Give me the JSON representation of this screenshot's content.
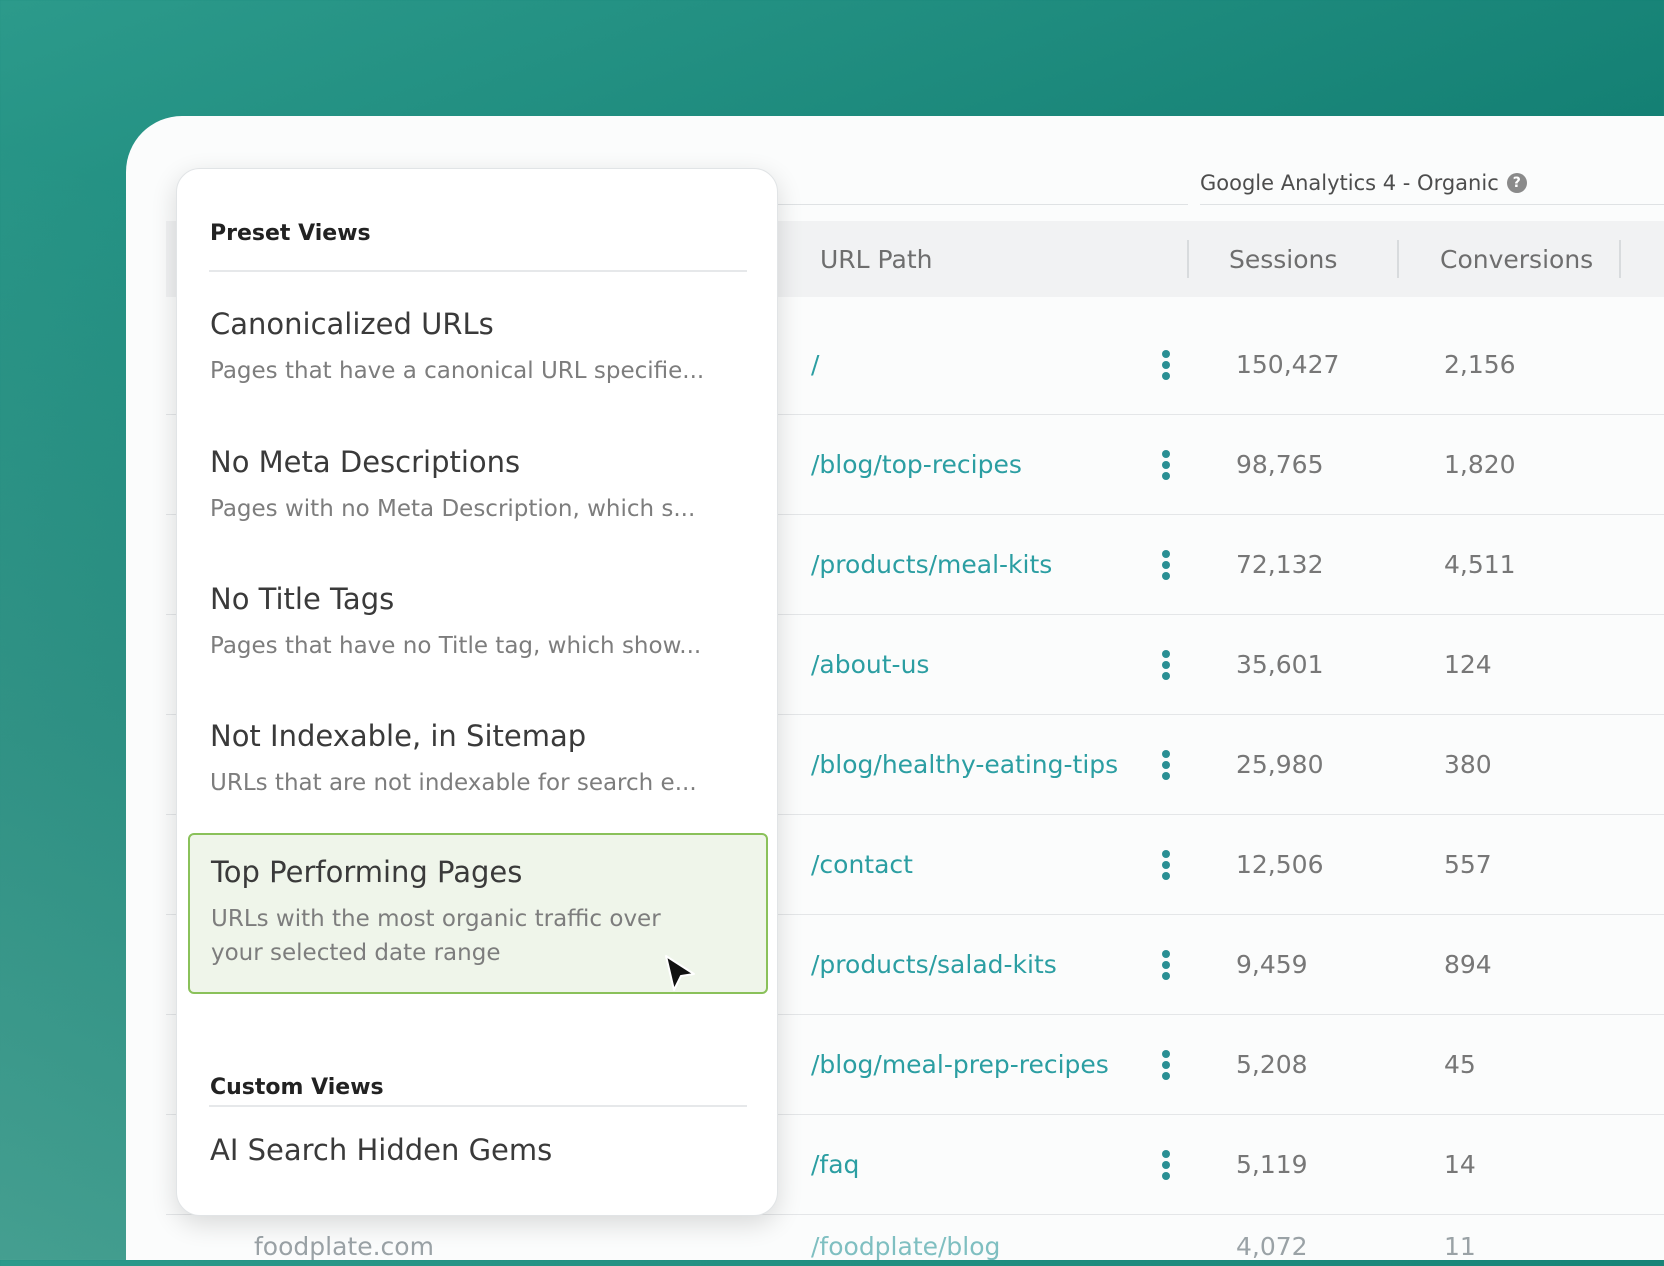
{
  "data_source": {
    "label": "Google Analytics 4 - Organic",
    "help_icon": "?"
  },
  "table": {
    "columns": [
      "URL Path",
      "Sessions",
      "Conversions"
    ],
    "rows": [
      {
        "url": "/",
        "sessions": "150,427",
        "conversions": "2,156"
      },
      {
        "url": "/blog/top-recipes",
        "sessions": "98,765",
        "conversions": "1,820"
      },
      {
        "url": "/products/meal-kits",
        "sessions": "72,132",
        "conversions": "4,511"
      },
      {
        "url": "/about-us",
        "sessions": "35,601",
        "conversions": "124"
      },
      {
        "url": "/blog/healthy-eating-tips",
        "sessions": "25,980",
        "conversions": "380"
      },
      {
        "url": "/contact",
        "sessions": "12,506",
        "conversions": "557"
      },
      {
        "url": "/products/salad-kits",
        "sessions": "9,459",
        "conversions": "894"
      },
      {
        "url": "/blog/meal-prep-recipes",
        "sessions": "5,208",
        "conversions": "45"
      },
      {
        "url": "/faq",
        "sessions": "5,119",
        "conversions": "14"
      }
    ],
    "partial_row": {
      "domain": "foodplate.com",
      "url": "/foodplate/blog",
      "sessions": "4,072",
      "conversions": "11"
    }
  },
  "dropdown": {
    "preset_title": "Preset Views",
    "presets": [
      {
        "title": "Canonicalized URLs",
        "desc": "Pages that have a canonical URL specifie..."
      },
      {
        "title": "No Meta Descriptions",
        "desc": "Pages with no Meta Description, which s..."
      },
      {
        "title": "No Title Tags",
        "desc": "Pages that have no Title tag, which show..."
      },
      {
        "title": "Not Indexable, in Sitemap",
        "desc": "URLs that are not indexable for search e..."
      },
      {
        "title": "Top Performing Pages",
        "desc": "URLs with the most organic traffic over your selected date range",
        "selected": true
      }
    ],
    "custom_title": "Custom Views",
    "customs": [
      {
        "title": "AI Search Hidden Gems"
      }
    ]
  },
  "colors": {
    "link": "#2b9ea2",
    "selected_bg": "#eff5ea",
    "selected_border": "#8ac15a",
    "background_teal": "#0a7d70"
  }
}
